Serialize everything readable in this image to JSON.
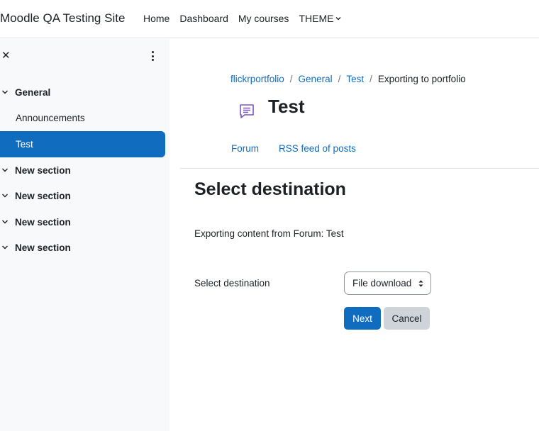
{
  "navbar": {
    "site_name": "Moodle QA Testing Site",
    "links": [
      "Home",
      "Dashboard",
      "My courses",
      "THEME"
    ]
  },
  "drawer": {
    "close_symbol": "✕",
    "sections": [
      {
        "label": "General",
        "activities": [
          "Announcements",
          "Test"
        ]
      },
      {
        "label": "New section"
      },
      {
        "label": "New section"
      },
      {
        "label": "New section"
      },
      {
        "label": "New section"
      }
    ],
    "active_activity": "Test"
  },
  "breadcrumb": [
    "flickrportfolio",
    "General",
    "Test",
    "Exporting to portfolio"
  ],
  "breadcrumb_separator": "/",
  "page": {
    "title": "Test",
    "icon": "forum-icon",
    "icon_color": "#7e57c2"
  },
  "secondary_nav": [
    "Forum",
    "RSS feed of posts"
  ],
  "content": {
    "heading": "Select destination",
    "info": "Exporting content from Forum: Test",
    "field_label": "Select destination",
    "select_value": "File download",
    "next_label": "Next",
    "cancel_label": "Cancel"
  },
  "colors": {
    "primary": "#0f6cbf",
    "secondary_button": "#ced4da",
    "drawer_bg": "#f8f9fa"
  }
}
